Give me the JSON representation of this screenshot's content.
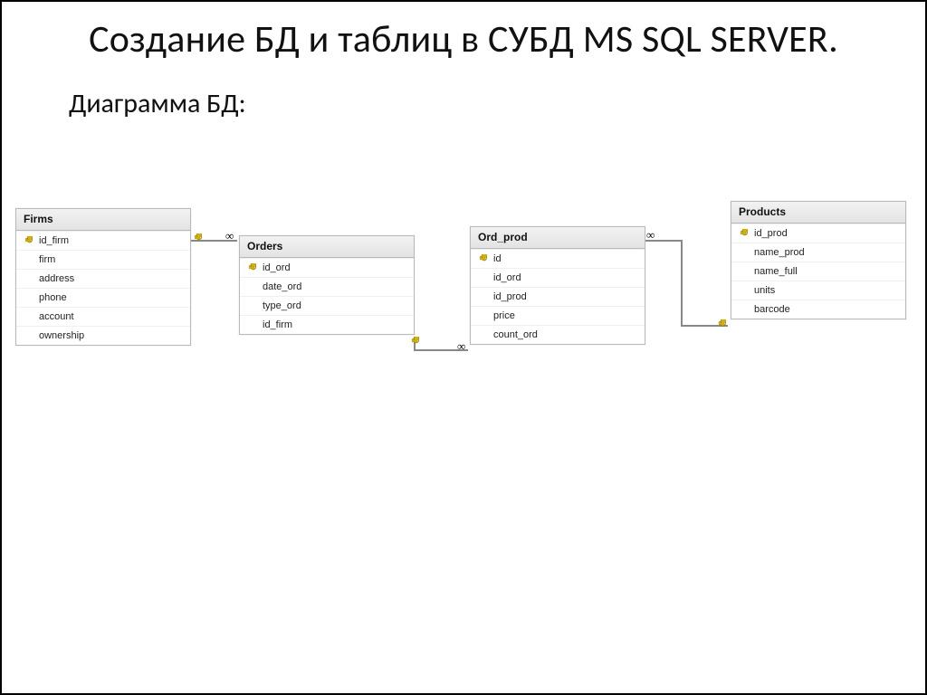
{
  "slide": {
    "title": "Создание БД и таблиц в СУБД MS SQL SERVER.",
    "subtitle": "Диаграмма БД:"
  },
  "tables": {
    "firms": {
      "name": "Firms",
      "fields": [
        {
          "name": "id_firm",
          "pk": true
        },
        {
          "name": "firm",
          "pk": false
        },
        {
          "name": "address",
          "pk": false
        },
        {
          "name": "phone",
          "pk": false
        },
        {
          "name": "account",
          "pk": false
        },
        {
          "name": "ownership",
          "pk": false
        }
      ]
    },
    "orders": {
      "name": "Orders",
      "fields": [
        {
          "name": "id_ord",
          "pk": true
        },
        {
          "name": "date_ord",
          "pk": false
        },
        {
          "name": "type_ord",
          "pk": false
        },
        {
          "name": "id_firm",
          "pk": false
        }
      ]
    },
    "ord_prod": {
      "name": "Ord_prod",
      "fields": [
        {
          "name": "id",
          "pk": true
        },
        {
          "name": "id_ord",
          "pk": false
        },
        {
          "name": "id_prod",
          "pk": false
        },
        {
          "name": "price",
          "pk": false
        },
        {
          "name": "count_ord",
          "pk": false
        }
      ]
    },
    "products": {
      "name": "Products",
      "fields": [
        {
          "name": "id_prod",
          "pk": true
        },
        {
          "name": "name_prod",
          "pk": false
        },
        {
          "name": "name_full",
          "pk": false
        },
        {
          "name": "units",
          "pk": false
        },
        {
          "name": "barcode",
          "pk": false
        }
      ]
    }
  },
  "relationships": [
    {
      "from": "Firms.id_firm",
      "to": "Orders.id_firm",
      "type": "one-to-many"
    },
    {
      "from": "Orders.id_ord",
      "to": "Ord_prod.id_ord",
      "type": "one-to-many"
    },
    {
      "from": "Products.id_prod",
      "to": "Ord_prod.id_prod",
      "type": "one-to-many"
    }
  ]
}
